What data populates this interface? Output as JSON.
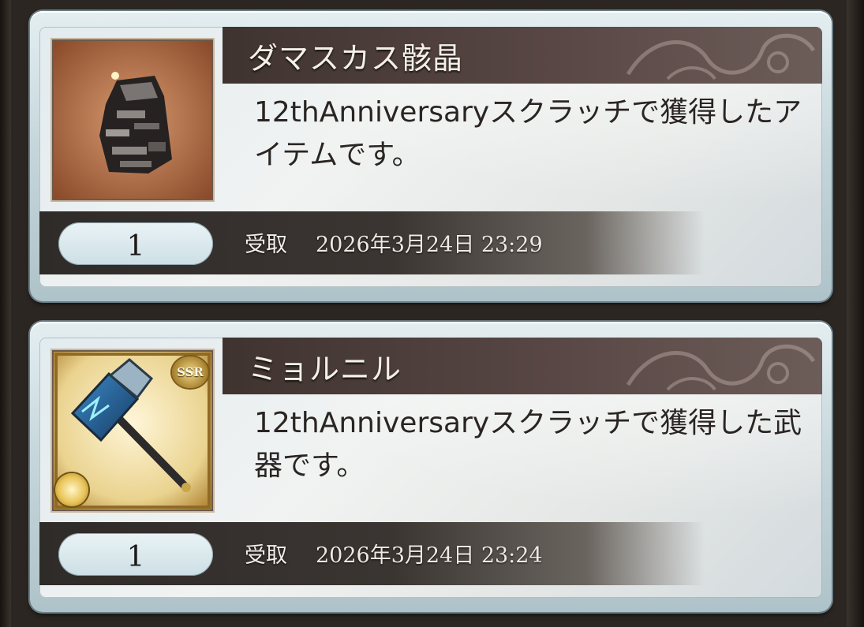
{
  "items": [
    {
      "name": "ダマスカス骸晶",
      "description": "12thAnniversaryスクラッチで獲得したアイテムです。",
      "count": "1",
      "received_label": "受取",
      "received_date": "2026年3月24日 23:29",
      "icon": "damascus-crystal-icon"
    },
    {
      "name": "ミョルニル",
      "description": "12thAnniversaryスクラッチで獲得した武器です。",
      "count": "1",
      "received_label": "受取",
      "received_date": "2026年3月24日 23:24",
      "icon": "mjolnir-hammer-icon",
      "rarity": "SSR"
    }
  ],
  "colors": {
    "title_bar": "#4a3b38",
    "card_frame": "#b9cdd3",
    "footer_bar": "#35302d"
  }
}
